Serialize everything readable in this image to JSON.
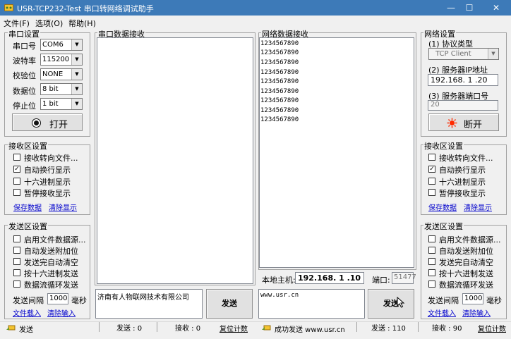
{
  "window": {
    "title": "USR-TCP232-Test 串口转网络调试助手"
  },
  "colors": {
    "title_bar": "#3d7ab8",
    "disconnect_icon": "#ff2a00",
    "link": "#0000cc"
  },
  "menu": [
    "文件(F)",
    "选项(O)",
    "帮助(H)"
  ],
  "serial_settings": {
    "title": "串口设置",
    "fields": [
      {
        "label": "串口号",
        "value": "COM6"
      },
      {
        "label": "波特率",
        "value": "115200"
      },
      {
        "label": "校验位",
        "value": "NONE"
      },
      {
        "label": "数据位",
        "value": "8 bit"
      },
      {
        "label": "停止位",
        "value": "1 bit"
      }
    ],
    "open_button": "打开"
  },
  "recv_settings_left": {
    "title": "接收区设置",
    "options": [
      {
        "label": "接收转向文件...",
        "checked": false
      },
      {
        "label": "自动换行显示",
        "checked": true
      },
      {
        "label": "十六进制显示",
        "checked": false
      },
      {
        "label": "暂停接收显示",
        "checked": false
      }
    ],
    "save_link": "保存数据",
    "clear_link": "清除显示"
  },
  "send_settings_left": {
    "title": "发送区设置",
    "options": [
      {
        "label": "启用文件数据源...",
        "checked": false
      },
      {
        "label": "自动发送附加位",
        "checked": false
      },
      {
        "label": "发送完自动清空",
        "checked": false
      },
      {
        "label": "按十六进制发送",
        "checked": false
      },
      {
        "label": "数据流循环发送",
        "checked": false
      }
    ],
    "interval_label": "发送间隔",
    "interval_value": "1000",
    "interval_unit": "毫秒",
    "file_link": "文件载入",
    "clear_link": "清除输入"
  },
  "serial_recv": {
    "title": "串口数据接收"
  },
  "serial_send": {
    "text": "济南有人物联网技术有限公司",
    "button": "发送"
  },
  "net_recv": {
    "title": "网络数据接收",
    "lines": [
      "1234567890",
      "1234567890",
      "1234567890",
      "1234567890",
      "1234567890",
      "1234567890",
      "1234567890",
      "1234567890",
      "1234567890"
    ]
  },
  "local_host": {
    "label": "本地主机:",
    "ip": "192.168. 1 .10",
    "port_label": "端口:",
    "port": "51477"
  },
  "net_send": {
    "text": "www.usr.cn",
    "button": "发送"
  },
  "net_settings": {
    "title": "网络设置",
    "protocol_label": "(1) 协议类型",
    "protocol_value": "TCP Client",
    "server_ip_label": "(2) 服务器IP地址",
    "server_ip": "192.168. 1 .20",
    "server_port_label": "(3) 服务器端口号",
    "server_port": "20",
    "disconnect_button": "断开"
  },
  "recv_settings_right": {
    "title": "接收区设置",
    "options": [
      {
        "label": "接收转向文件...",
        "checked": false
      },
      {
        "label": "自动换行显示",
        "checked": true
      },
      {
        "label": "十六进制显示",
        "checked": false
      },
      {
        "label": "暂停接收显示",
        "checked": false
      }
    ],
    "save_link": "保存数据",
    "clear_link": "清除显示"
  },
  "send_settings_right": {
    "title": "发送区设置",
    "options": [
      {
        "label": "启用文件数据源...",
        "checked": false
      },
      {
        "label": "自动发送附加位",
        "checked": false
      },
      {
        "label": "发送完自动清空",
        "checked": false
      },
      {
        "label": "按十六进制发送",
        "checked": false
      },
      {
        "label": "数据流循环发送",
        "checked": false
      }
    ],
    "interval_label": "发送间隔",
    "interval_value": "1000",
    "interval_unit": "毫秒",
    "file_link": "文件载入",
    "clear_link": "清除输入"
  },
  "status_left": {
    "message": "发送",
    "sent": "发送 : 0",
    "received": "接收 : 0",
    "reset": "复位计数"
  },
  "status_right": {
    "message": "成功发送 www.usr.cn",
    "sent": "发送 : 110",
    "received": "接收 : 90",
    "reset": "复位计数"
  }
}
